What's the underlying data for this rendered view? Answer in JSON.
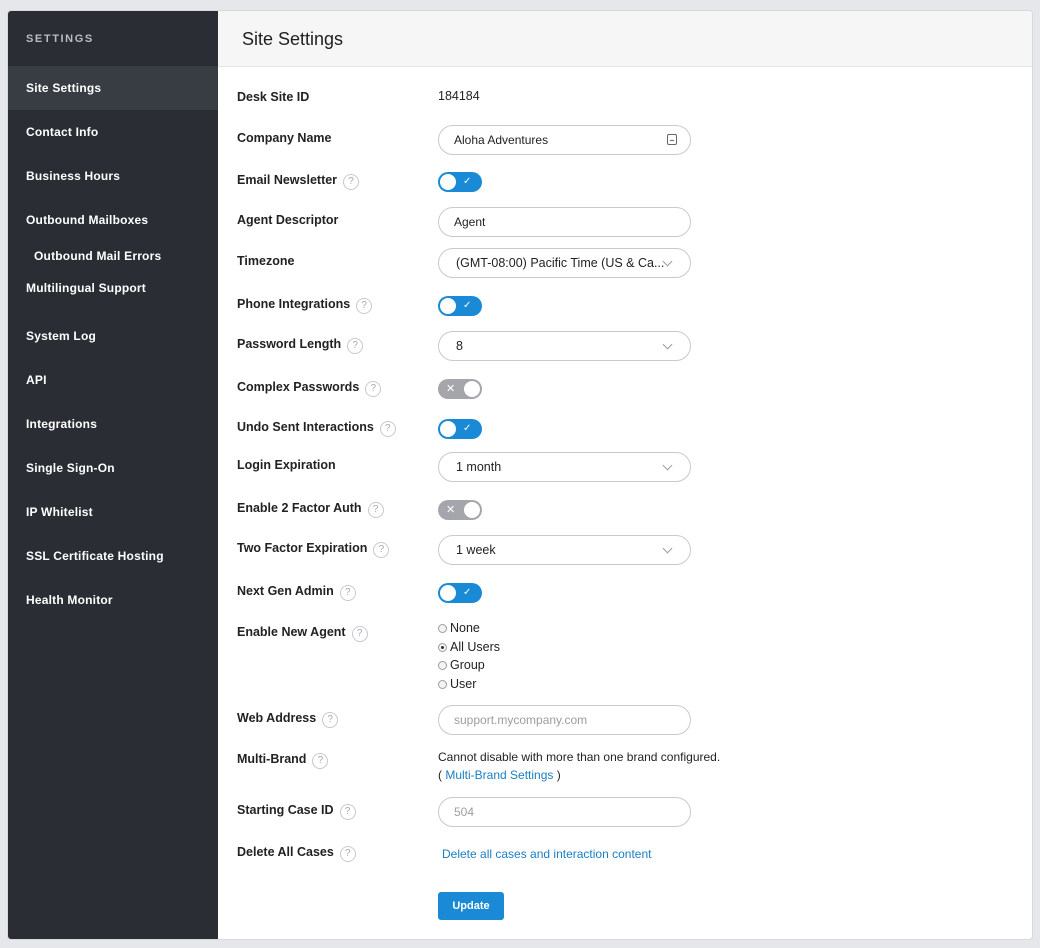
{
  "sidebar": {
    "title": "SETTINGS",
    "items": [
      {
        "label": "Site Settings"
      },
      {
        "label": "Contact Info"
      },
      {
        "label": "Business Hours"
      },
      {
        "label": "Outbound Mailboxes"
      },
      {
        "label": "Outbound Mail Errors"
      },
      {
        "label": "Multilingual Support"
      },
      {
        "label": "System Log"
      },
      {
        "label": "API"
      },
      {
        "label": "Integrations"
      },
      {
        "label": "Single Sign-On"
      },
      {
        "label": "IP Whitelist"
      },
      {
        "label": "SSL Certificate Hosting"
      },
      {
        "label": "Health Monitor"
      }
    ]
  },
  "header": {
    "title": "Site Settings"
  },
  "help_glyph": "?",
  "toggle_on_glyph": "✓",
  "toggle_off_glyph": "✕",
  "fields": {
    "site_id": {
      "label": "Desk Site ID",
      "value": "184184"
    },
    "company_name": {
      "label": "Company Name",
      "value": "Aloha Adventures"
    },
    "email_newsletter": {
      "label": "Email Newsletter",
      "on": true
    },
    "agent_descriptor": {
      "label": "Agent Descriptor",
      "value": "Agent"
    },
    "timezone": {
      "label": "Timezone",
      "value": "(GMT-08:00) Pacific Time (US & Ca..."
    },
    "phone_integrations": {
      "label": "Phone Integrations",
      "on": true
    },
    "password_length": {
      "label": "Password Length",
      "value": "8"
    },
    "complex_passwords": {
      "label": "Complex Passwords",
      "on": false
    },
    "undo_sent": {
      "label": "Undo Sent Interactions",
      "on": true
    },
    "login_expiration": {
      "label": "Login Expiration",
      "value": "1 month"
    },
    "two_factor_auth": {
      "label": "Enable 2 Factor Auth",
      "on": false
    },
    "two_factor_expiration": {
      "label": "Two Factor Expiration",
      "value": "1 week"
    },
    "next_gen_admin": {
      "label": "Next Gen Admin",
      "on": true
    },
    "enable_new_agent": {
      "label": "Enable New Agent",
      "options": [
        "None",
        "All Users",
        "Group",
        "User"
      ],
      "selected": "All Users"
    },
    "web_address": {
      "label": "Web Address",
      "placeholder": "support.mycompany.com"
    },
    "multi_brand": {
      "label": "Multi-Brand",
      "note": "Cannot disable with more than one brand configured.",
      "link_prefix": "( ",
      "link": "Multi-Brand Settings",
      "link_suffix": " )"
    },
    "starting_case_id": {
      "label": "Starting Case ID",
      "placeholder": "504"
    },
    "delete_all_cases": {
      "label": "Delete All Cases",
      "link": "Delete all cases and interaction content"
    }
  },
  "actions": {
    "update_label": "Update"
  },
  "colors": {
    "accent": "#1b8ad6",
    "sidebar_bg": "#2a2e34",
    "sidebar_active": "#383c43",
    "toggle_off": "#a4a6ab",
    "link": "#1a7ec4"
  }
}
